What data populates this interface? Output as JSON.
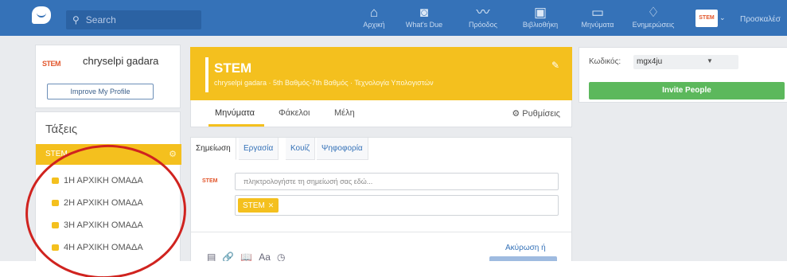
{
  "topbar": {
    "search_placeholder": "Search",
    "nav": [
      {
        "label": "Αρχική",
        "icon": "home-icon",
        "glyph": "⌂"
      },
      {
        "label": "What's Due",
        "icon": "calendar-icon",
        "glyph": "◙"
      },
      {
        "label": "Πρόοδος",
        "icon": "progress-icon",
        "glyph": "〰"
      },
      {
        "label": "Βιβλιοθήκη",
        "icon": "library-icon",
        "glyph": "▣"
      },
      {
        "label": "Μηνύματα",
        "icon": "messages-icon",
        "glyph": "▭"
      },
      {
        "label": "Ενημερώσεις",
        "icon": "bell-icon",
        "glyph": "♢"
      }
    ],
    "avatar_text": "STEM",
    "invite_label": "Προσκαλέσ"
  },
  "profile": {
    "logo_text": "STEM",
    "name": "chryselpi gadara",
    "improve_label": "Improve My Profile"
  },
  "classes": {
    "title": "Τάξεις",
    "active": "STEM",
    "groups": [
      "1Η ΑΡΧΙΚΗ ΟΜΑΔΑ",
      "2Η ΑΡΧΙΚΗ ΟΜΑΔΑ",
      "3Η ΑΡΧΙΚΗ ΟΜΑΔΑ",
      "4Η ΑΡΧΙΚΗ ΟΜΑΔΑ"
    ]
  },
  "header": {
    "title": "STEM",
    "subtitle": "chryselpi gadara · 5th Βαθμός-7th Βαθμός · Τεχνολογία Υπολογιστών",
    "tabs": [
      "Μηνύματα",
      "Φάκελοι",
      "Μέλη"
    ],
    "settings_label": "Ρυθμίσεις"
  },
  "composer": {
    "tabs": [
      "Σημείωση",
      "Εργασία",
      "Κουίζ",
      "Ψηφοφορία"
    ],
    "logo_text": "STEM",
    "note_placeholder": "πληκτρολογήστε τη σημείωσή σας εδώ...",
    "recipient_chip": "STEM",
    "tools_text": "Aa",
    "cancel_label": "Ακύρωση ή"
  },
  "right": {
    "code_label": "Κωδικός:",
    "code_value": "mgx4ju",
    "invite_label": "Invite People"
  },
  "colors": {
    "nav_blue": "#3572b8",
    "accent_yellow": "#f4c01e",
    "invite_green": "#5cb85c",
    "annotation_red": "#d0231f"
  }
}
